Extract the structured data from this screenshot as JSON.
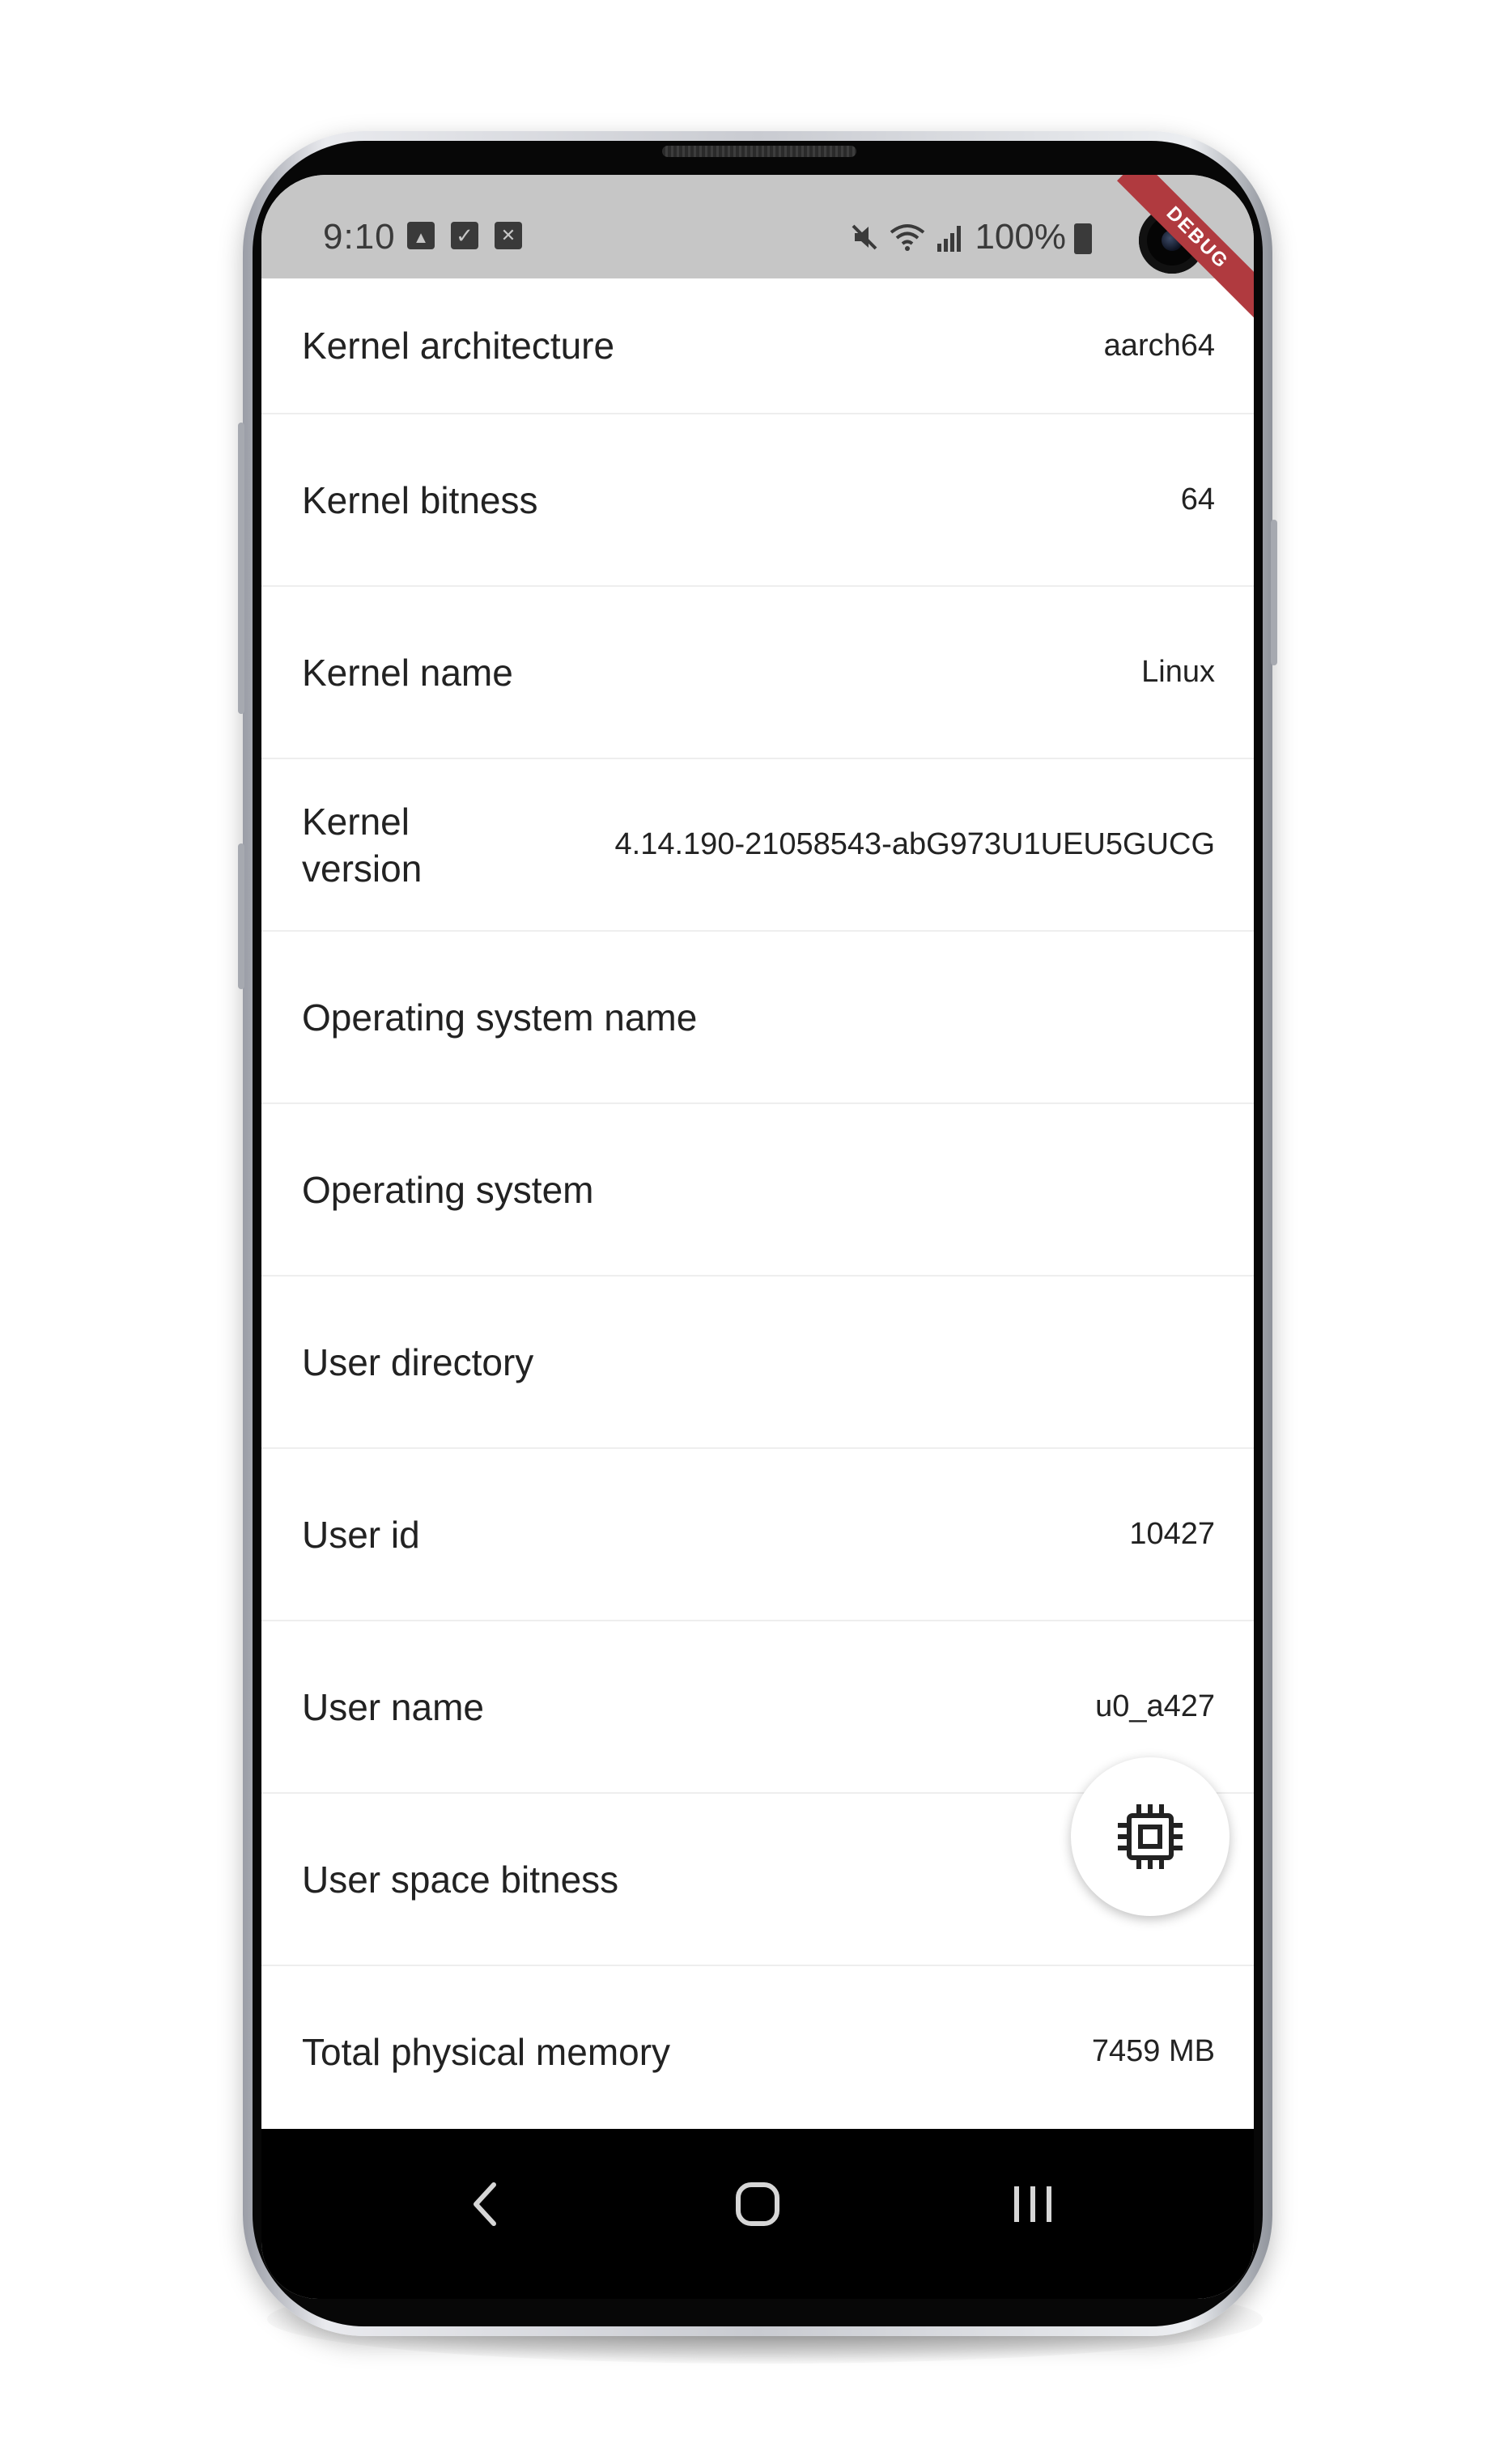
{
  "status_bar": {
    "time": "9:10",
    "notification_icons": [
      "image-icon",
      "check-icon",
      "close-icon"
    ],
    "system_icons": [
      "mute-icon",
      "wifi-icon",
      "signal-icon"
    ],
    "battery": "100%",
    "debug_banner": "DEBUG"
  },
  "rows": [
    {
      "label": "Kernel architecture",
      "value": "aarch64"
    },
    {
      "label": "Kernel bitness",
      "value": "64"
    },
    {
      "label": "Kernel name",
      "value": "Linux"
    },
    {
      "label": "Kernel version",
      "value": "4.14.190-21058543-abG973U1UEU5GUCG"
    },
    {
      "label": "Operating system name",
      "value": ""
    },
    {
      "label": "Operating system",
      "value": ""
    },
    {
      "label": "User directory",
      "value": ""
    },
    {
      "label": "User id",
      "value": "10427"
    },
    {
      "label": "User name",
      "value": "u0_a427"
    },
    {
      "label": "User space bitness",
      "value": ""
    },
    {
      "label": "Total physical memory",
      "value": "7459 MB"
    }
  ],
  "fab": {
    "icon": "memory-chip-icon"
  },
  "nav_bar": {
    "buttons": [
      "back-icon",
      "home-icon",
      "recents-icon"
    ]
  },
  "colors": {
    "status_bar": "#c6c6c6",
    "debug_banner": "#b03a3f",
    "nav_bar": "#000000"
  }
}
